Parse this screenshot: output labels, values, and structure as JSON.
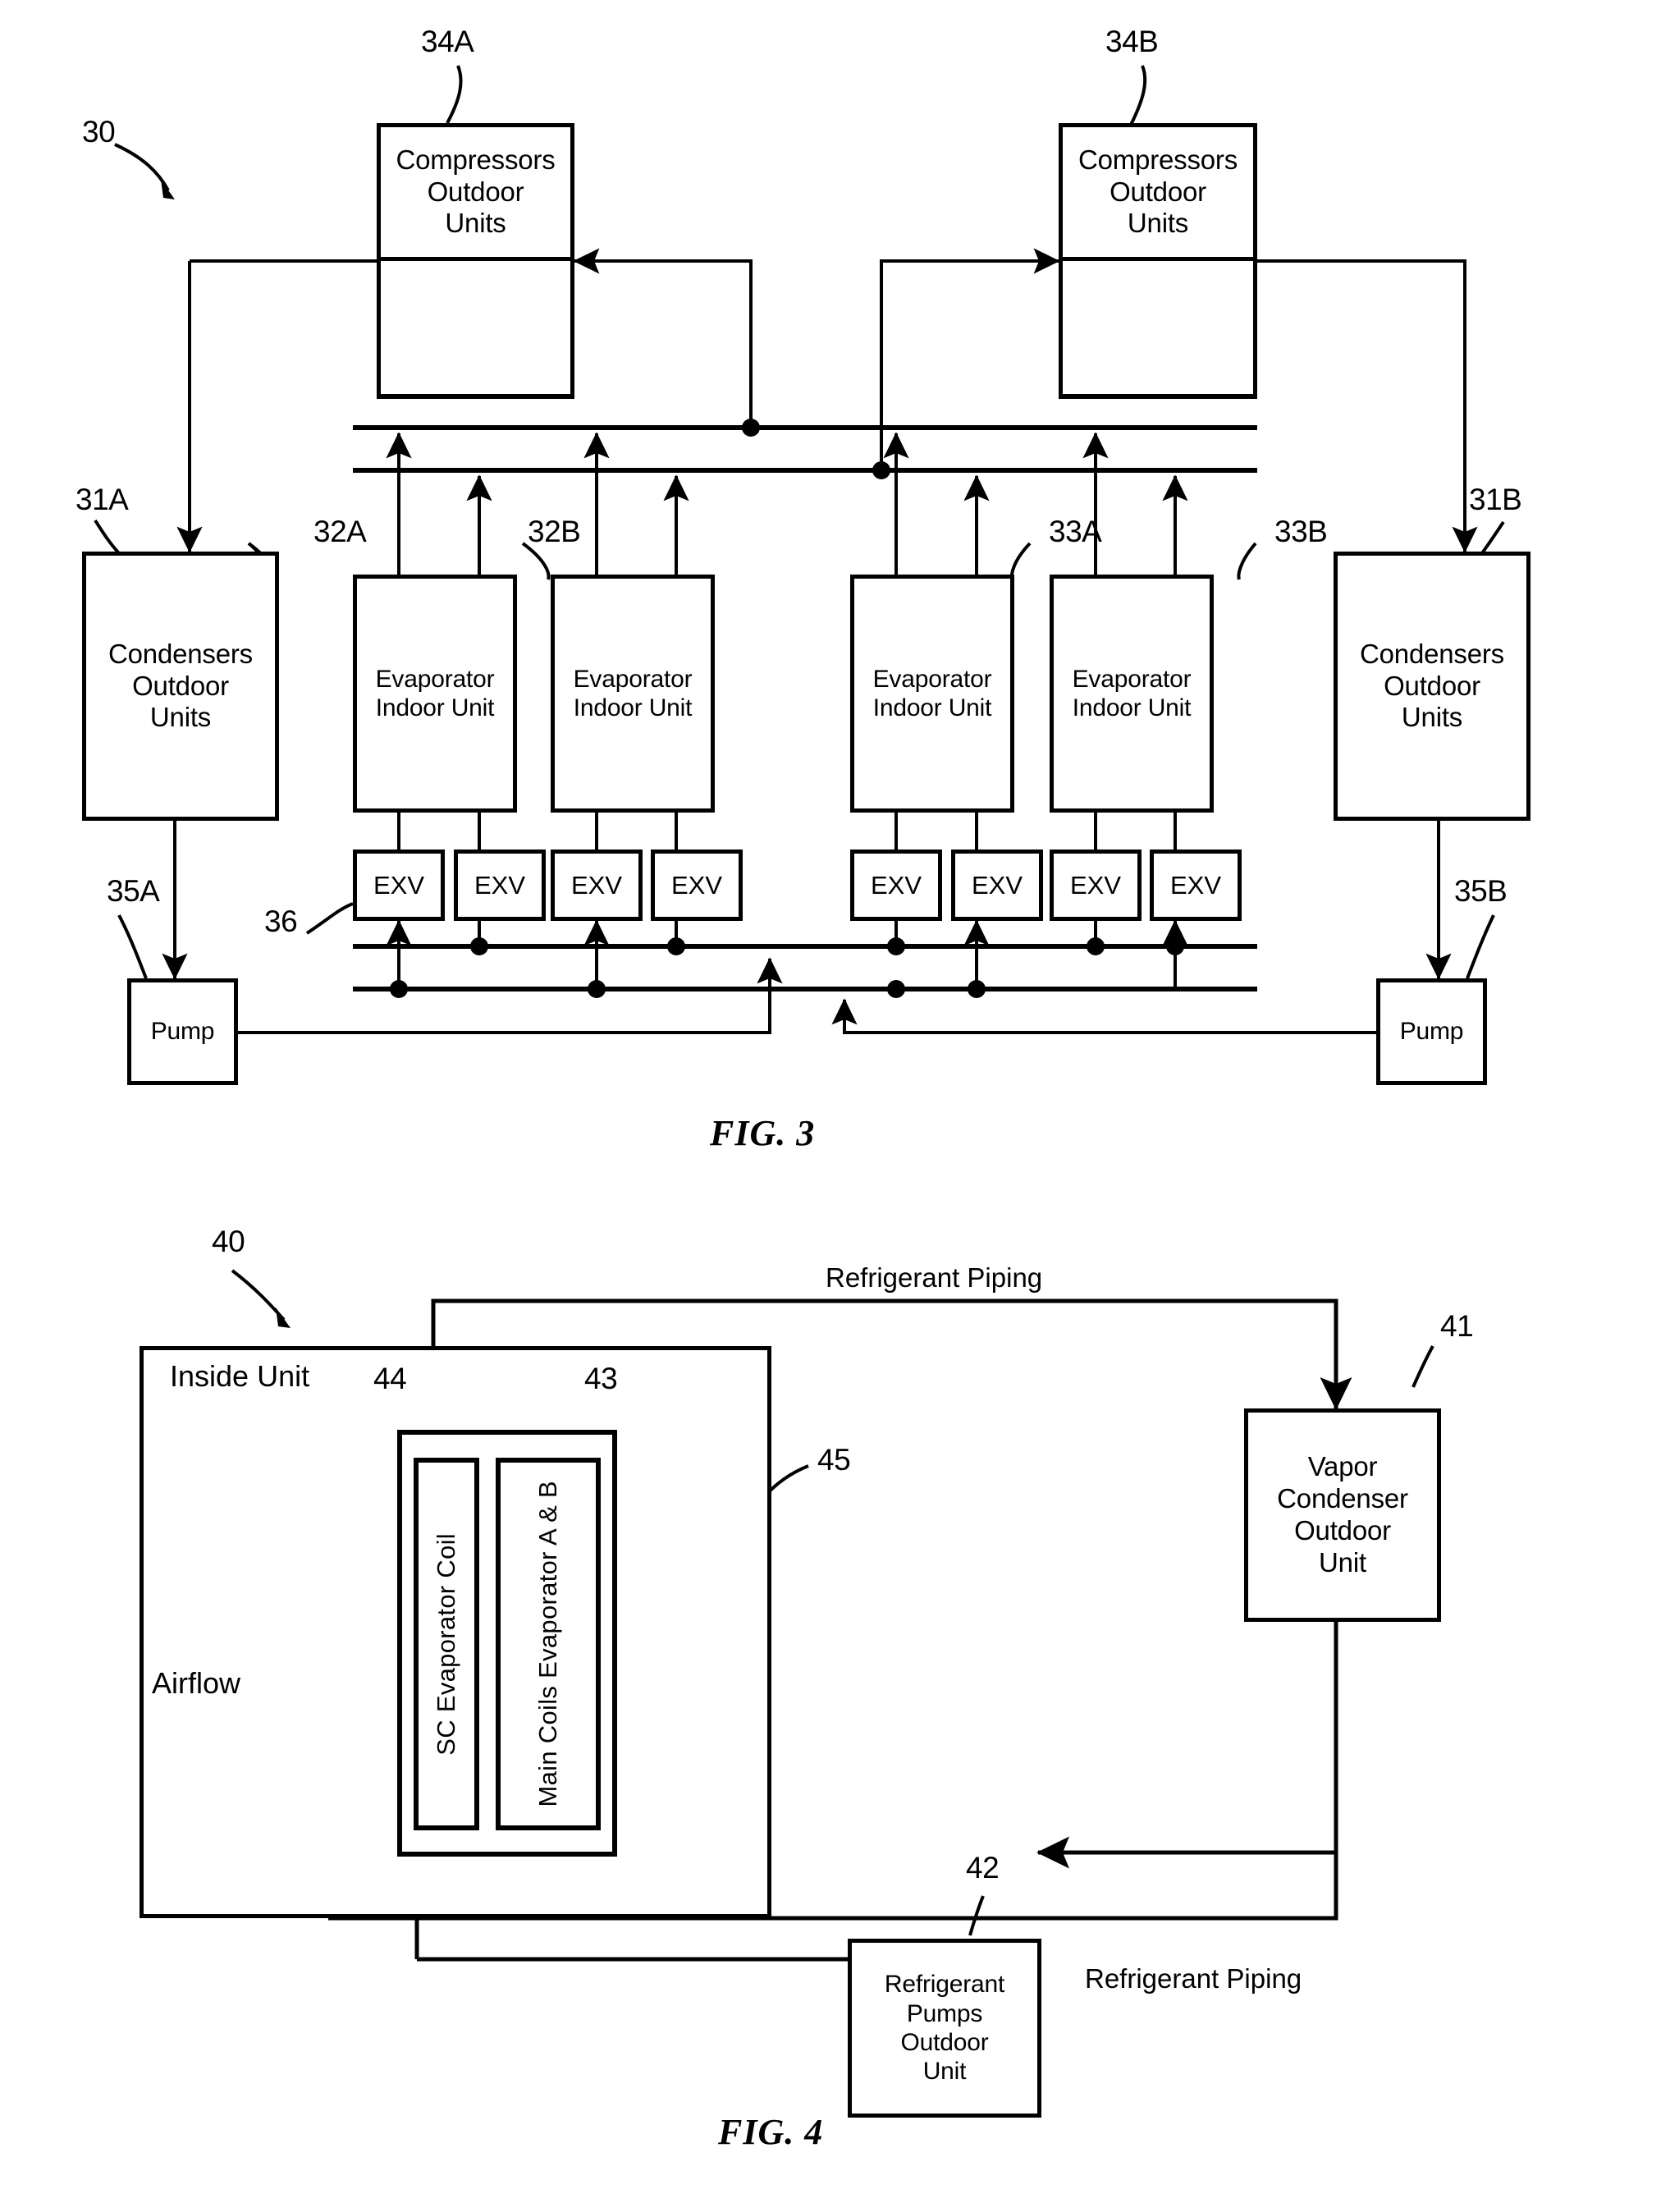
{
  "document": {
    "type": "patent-figure-sheet",
    "figures": [
      "FIG. 3",
      "FIG. 4"
    ]
  },
  "fig3": {
    "caption": "FIG. 3",
    "system_ref": "30",
    "blocks": {
      "compressor_a": {
        "ref": "34A",
        "label": "Compressors\nOutdoor\nUnits",
        "lines": [
          "Compressors",
          "Outdoor",
          "Units"
        ]
      },
      "compressor_b": {
        "ref": "34B",
        "label": "Compressors\nOutdoor\nUnits",
        "lines": [
          "Compressors",
          "Outdoor",
          "Units"
        ]
      },
      "condenser_a": {
        "ref": "31A",
        "lines": [
          "Condensers",
          "Outdoor",
          "Units"
        ]
      },
      "condenser_b": {
        "ref": "31B",
        "lines": [
          "Condensers",
          "Outdoor",
          "Units"
        ]
      },
      "evaporator_1": {
        "ref": "32A",
        "lines": [
          "Evaporator",
          "Indoor Unit"
        ]
      },
      "evaporator_2": {
        "ref": "32B",
        "lines": [
          "Evaporator",
          "Indoor Unit"
        ]
      },
      "evaporator_3": {
        "ref": "33A",
        "lines": [
          "Evaporator",
          "Indoor Unit"
        ]
      },
      "evaporator_4": {
        "ref": "33B",
        "lines": [
          "Evaporator",
          "Indoor Unit"
        ]
      },
      "pump_a": {
        "ref": "35A",
        "label": "Pump"
      },
      "pump_b": {
        "ref": "35B",
        "label": "Pump"
      }
    },
    "exv": {
      "ref": "36",
      "label": "EXV",
      "count": 8
    }
  },
  "fig4": {
    "caption": "FIG. 4",
    "system_ref": "40",
    "inside_unit_label": "Inside Unit",
    "airflow_label": "Airflow",
    "refrigerant_piping_top": "Refrigerant Piping",
    "refrigerant_piping_bottom": "Refrigerant Piping",
    "blocks": {
      "sc_evaporator_coil": {
        "ref": "44",
        "label": "SC Evaporator Coil"
      },
      "main_coils": {
        "ref": "43",
        "label": "Main Coils Evaporator A & B"
      },
      "vapor_condenser": {
        "ref": "41",
        "lines": [
          "Vapor",
          "Condenser",
          "Outdoor",
          "Unit"
        ]
      },
      "refrigerant_pumps": {
        "ref": "42",
        "lines": [
          "Refrigerant",
          "Pumps",
          "Outdoor",
          "Unit"
        ]
      },
      "airflow_outlet": {
        "ref": "45"
      }
    }
  },
  "colors": {
    "ink": "#000000",
    "paper": "#ffffff"
  }
}
